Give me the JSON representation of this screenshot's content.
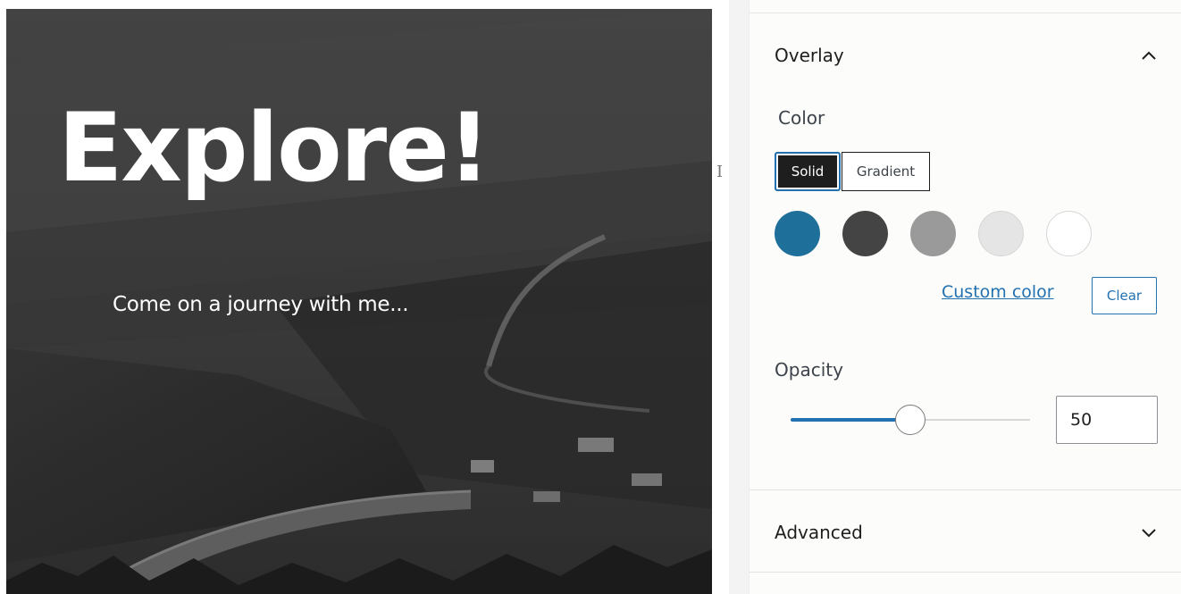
{
  "cover": {
    "title": "Explore!",
    "subtitle": "Come on a journey with me..."
  },
  "inspector": {
    "overlay": {
      "title": "Overlay",
      "expanded": true,
      "color_label": "Color",
      "tabs": {
        "solid": "Solid",
        "gradient": "Gradient",
        "active": "solid"
      },
      "swatches": [
        {
          "name": "blue",
          "color": "#1f6f9b"
        },
        {
          "name": "dark-gray",
          "color": "#444444"
        },
        {
          "name": "gray",
          "color": "#9a9a9a"
        },
        {
          "name": "light-gray",
          "color": "#e5e5e5"
        },
        {
          "name": "white",
          "color": "#ffffff"
        }
      ],
      "custom_color_label": "Custom color",
      "clear_label": "Clear",
      "opacity_label": "Opacity",
      "opacity_value": "50",
      "opacity_max": 100
    },
    "advanced": {
      "title": "Advanced",
      "expanded": false
    }
  },
  "colors": {
    "accent": "#2271b1",
    "panel_bg": "#fcfcfa",
    "overlay_tint": "#000000"
  }
}
